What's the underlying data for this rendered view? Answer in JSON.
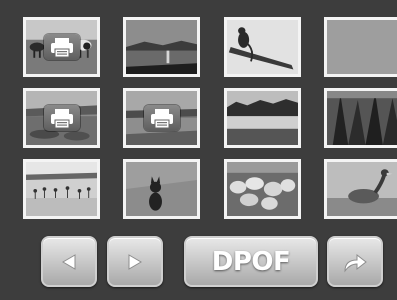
{
  "thumbnails": [
    {
      "subject": "cows-in-field",
      "selected_for_print": true
    },
    {
      "subject": "lake-sunset",
      "selected_for_print": false
    },
    {
      "subject": "monkey-on-branch",
      "selected_for_print": false
    },
    {
      "subject": "blank-gray",
      "selected_for_print": false
    },
    {
      "subject": "lake-shore",
      "selected_for_print": true
    },
    {
      "subject": "lake-reeds",
      "selected_for_print": true
    },
    {
      "subject": "lake-forest",
      "selected_for_print": false
    },
    {
      "subject": "pine-forest",
      "selected_for_print": false
    },
    {
      "subject": "birds-on-water",
      "selected_for_print": false
    },
    {
      "subject": "fox-in-grass",
      "selected_for_print": false
    },
    {
      "subject": "sheep-flock",
      "selected_for_print": false
    },
    {
      "subject": "goose-on-water",
      "selected_for_print": false
    }
  ],
  "toolbar": {
    "prev_icon": "triangle-left-icon",
    "next_icon": "triangle-right-icon",
    "dpof_label": "DPOF",
    "return_icon": "curved-arrow-icon"
  },
  "icons": {
    "print_badge": "printer-icon"
  },
  "colors": {
    "background": "#3d3d3d",
    "thumb_border": "#f4f4f4",
    "button_top": "#e8e8e8",
    "button_bottom": "#a9a9a9"
  }
}
